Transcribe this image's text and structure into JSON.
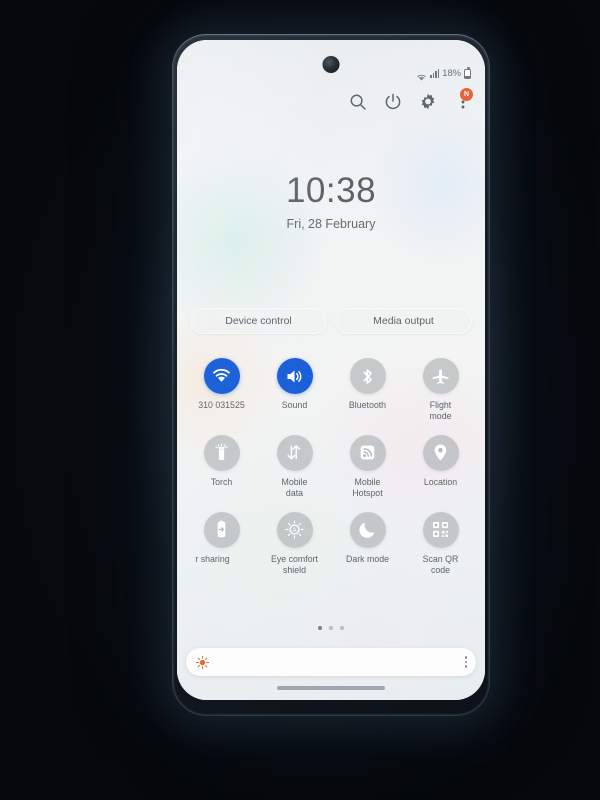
{
  "device": {
    "platform": "Android phone quick settings panel",
    "camera_icon": "front-camera-punch-hole"
  },
  "status_bar": {
    "wifi_icon": "wifi-icon",
    "signal_icon": "cellular-signal-icon",
    "battery_percent": "18%",
    "battery_icon": "battery-icon"
  },
  "header": {
    "search_icon": "search-icon",
    "power_icon": "power-icon",
    "settings_icon": "gear-icon",
    "more_icon": "more-vertical-icon",
    "badge_label": "N"
  },
  "clock": {
    "time": "10:38",
    "date": "Fri, 28 February"
  },
  "pills": [
    {
      "label": "Device control",
      "name": "device-control-button"
    },
    {
      "label": "Media output",
      "name": "media-output-button"
    }
  ],
  "quick_settings": [
    {
      "label": "310 031525",
      "icon": "wifi-icon",
      "name": "toggle-wifi",
      "active": true
    },
    {
      "label": "Sound",
      "icon": "sound-icon",
      "name": "toggle-sound",
      "active": true
    },
    {
      "label": "Bluetooth",
      "icon": "bluetooth-icon",
      "name": "toggle-bluetooth",
      "active": false
    },
    {
      "label": "Flight\nmode",
      "icon": "airplane-icon",
      "name": "toggle-flight-mode",
      "active": false
    },
    {
      "label": "Torch",
      "icon": "flashlight-icon",
      "name": "toggle-torch",
      "active": false
    },
    {
      "label": "Mobile\ndata",
      "icon": "mobile-data-icon",
      "name": "toggle-mobile-data",
      "active": false
    },
    {
      "label": "Mobile\nHotspot",
      "icon": "hotspot-icon",
      "name": "toggle-mobile-hotspot",
      "active": false
    },
    {
      "label": "Location",
      "icon": "location-pin-icon",
      "name": "toggle-location",
      "active": false
    },
    {
      "label": "r sharing",
      "icon": "power-sharing-icon",
      "name": "toggle-power-sharing",
      "active": false
    },
    {
      "label": "Eye comfort\nshield",
      "icon": "eye-comfort-icon",
      "name": "toggle-eye-comfort",
      "active": false
    },
    {
      "label": "Dark mode",
      "icon": "moon-icon",
      "name": "toggle-dark-mode",
      "active": false
    },
    {
      "label": "Scan QR\ncode",
      "icon": "qr-code-icon",
      "name": "toggle-scan-qr",
      "active": false
    }
  ],
  "pagination": {
    "count": 3,
    "active_index": 0
  },
  "brightness": {
    "sun_icon": "brightness-sun-icon",
    "more_icon": "more-vertical-icon",
    "value_percent": 4
  },
  "colors": {
    "accent_blue": "#1a5fd8",
    "inactive_gray": "#aaaeb0",
    "badge_orange": "#e8623a",
    "sun_orange": "#e8652f",
    "text_gray": "#5e646c"
  }
}
